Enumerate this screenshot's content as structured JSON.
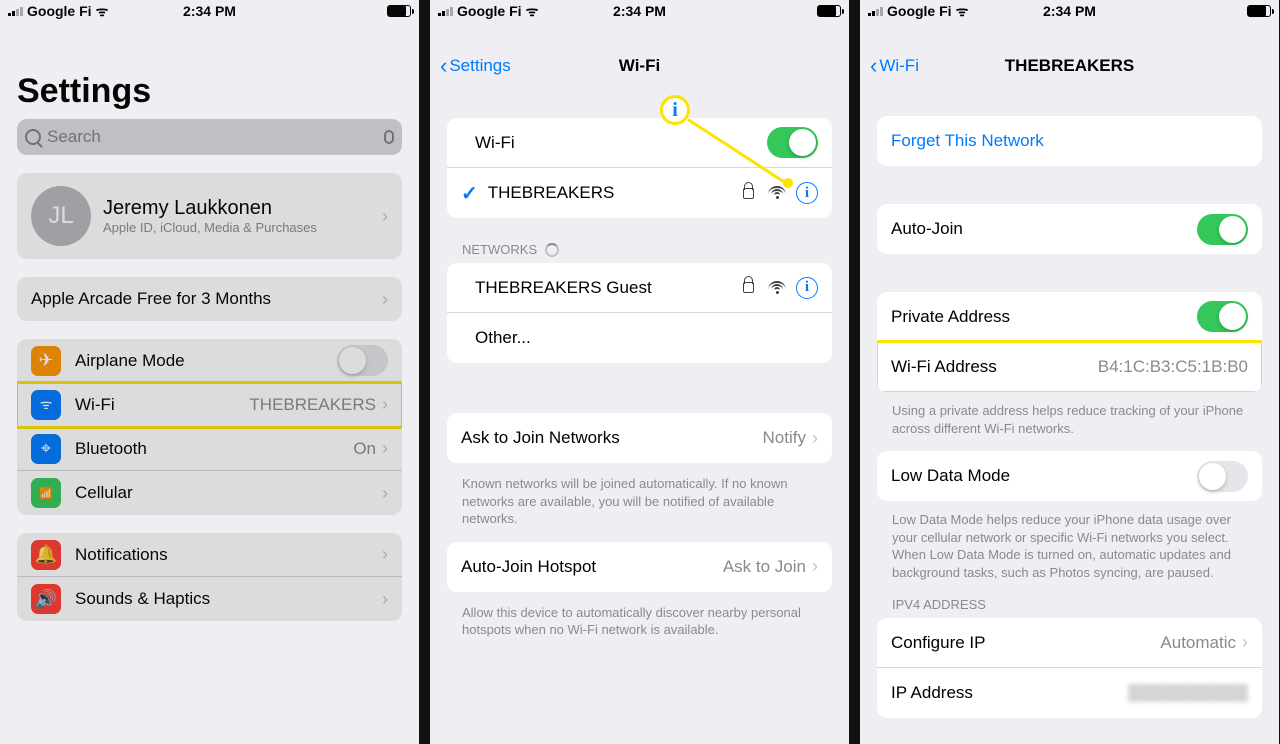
{
  "status_bar": {
    "carrier": "Google Fi",
    "time": "2:34 PM"
  },
  "phone1": {
    "title": "Settings",
    "search_placeholder": "Search",
    "profile": {
      "initials": "JL",
      "name": "Jeremy Laukkonen",
      "subtitle": "Apple ID, iCloud, Media & Purchases"
    },
    "promo": "Apple Arcade Free for 3 Months",
    "rows": {
      "airplane": "Airplane Mode",
      "wifi": "Wi-Fi",
      "wifi_value": "THEBREAKERS",
      "bluetooth": "Bluetooth",
      "bluetooth_value": "On",
      "cellular": "Cellular",
      "notifications": "Notifications",
      "sounds": "Sounds & Haptics"
    }
  },
  "phone2": {
    "back": "Settings",
    "title": "Wi-Fi",
    "wifi_row": "Wi-Fi",
    "connected": "THEBREAKERS",
    "networks_header": "NETWORKS",
    "guest": "THEBREAKERS Guest",
    "other": "Other...",
    "ask_join": "Ask to Join Networks",
    "ask_join_value": "Notify",
    "ask_join_footer": "Known networks will be joined automatically. If no known networks are available, you will be notified of available networks.",
    "auto_hotspot": "Auto-Join Hotspot",
    "auto_hotspot_value": "Ask to Join",
    "auto_hotspot_footer": "Allow this device to automatically discover nearby personal hotspots when no Wi-Fi network is available."
  },
  "phone3": {
    "back": "Wi-Fi",
    "title": "THEBREAKERS",
    "forget": "Forget This Network",
    "auto_join": "Auto-Join",
    "private_addr": "Private Address",
    "wifi_addr_label": "Wi-Fi Address",
    "wifi_addr_value": "B4:1C:B3:C5:1B:B0",
    "private_footer": "Using a private address helps reduce tracking of your iPhone across different Wi-Fi networks.",
    "low_data": "Low Data Mode",
    "low_data_footer": "Low Data Mode helps reduce your iPhone data usage over your cellular network or specific Wi-Fi networks you select. When Low Data Mode is turned on, automatic updates and background tasks, such as Photos syncing, are paused.",
    "ipv4_header": "IPV4 ADDRESS",
    "configure_ip": "Configure IP",
    "configure_ip_value": "Automatic",
    "ip_addr": "IP Address"
  }
}
